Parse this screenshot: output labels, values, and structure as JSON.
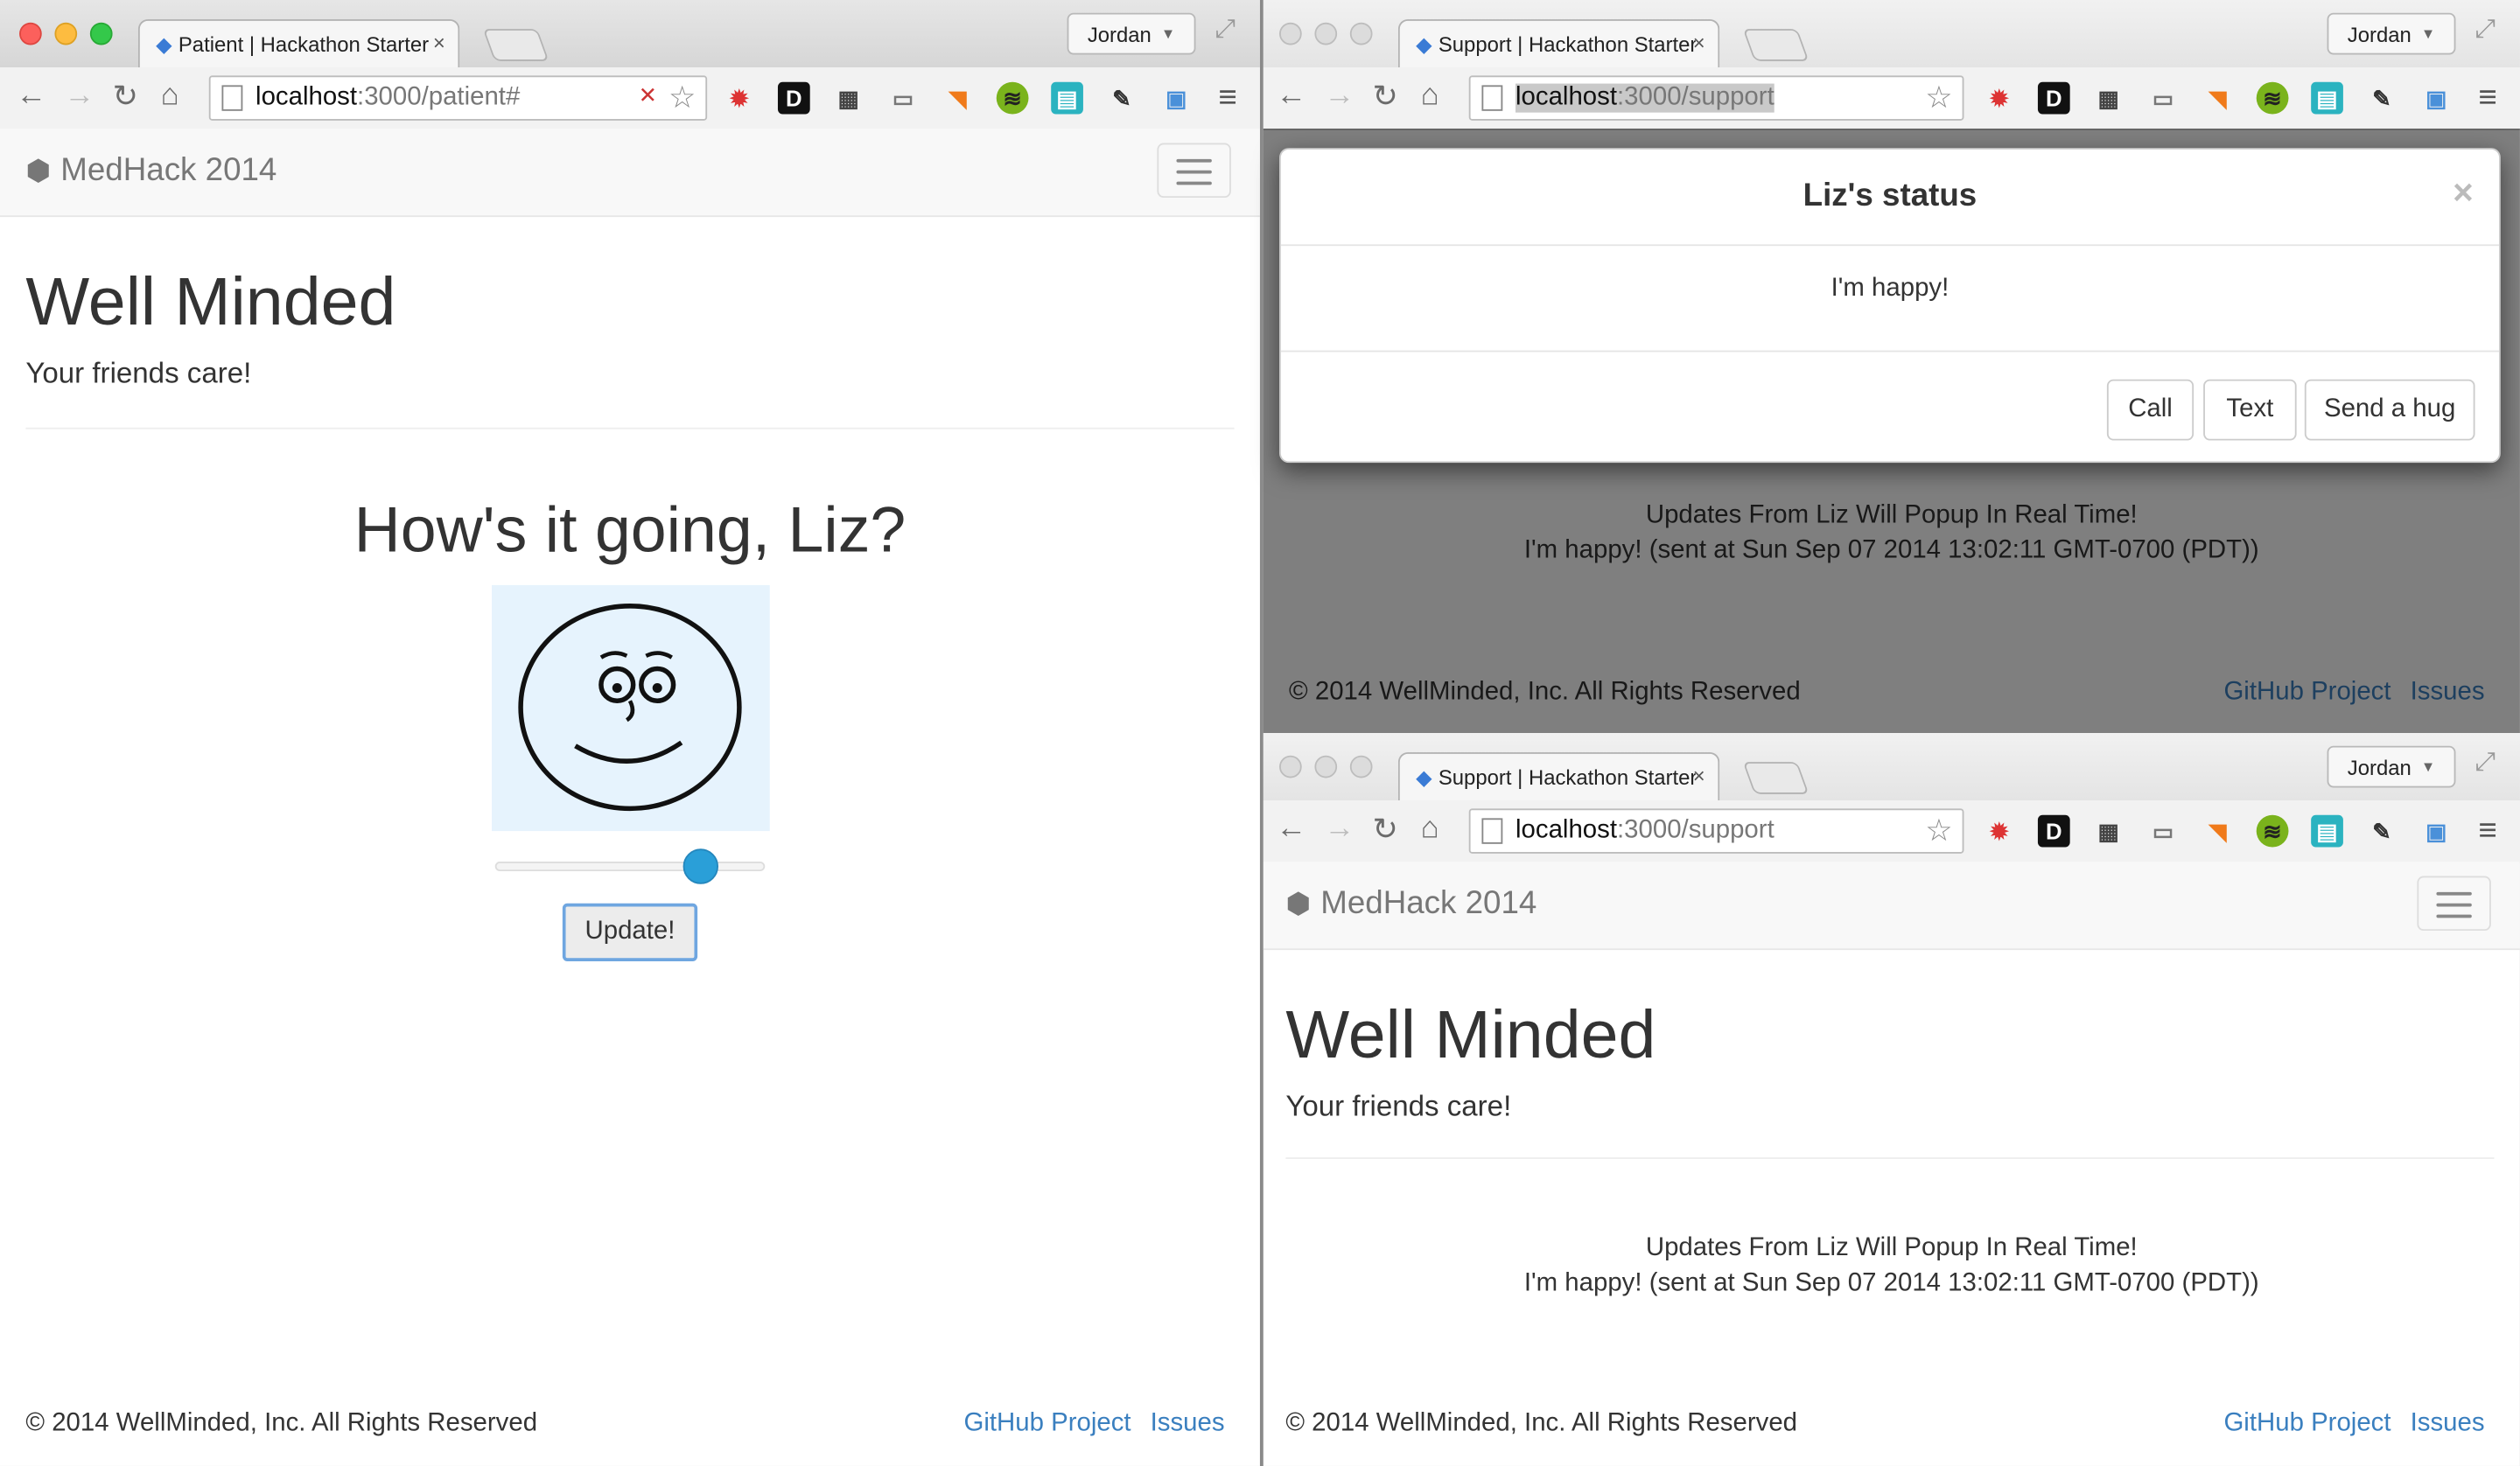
{
  "left_window": {
    "tab_title": "Patient | Hackathon Starter",
    "profile": "Jordan",
    "url_host": "localhost",
    "url_path": ":3000/patient#",
    "brand": "MedHack 2014",
    "heading": "Well Minded",
    "subheading": "Your friends care!",
    "greeting": "How's it going, Liz?",
    "mood_slider_fraction": 0.8,
    "update_button": "Update!",
    "footer_copyright": "© 2014 WellMinded, Inc. All Rights Reserved",
    "footer_link_github": "GitHub Project",
    "footer_link_issues": "Issues"
  },
  "right_top_window": {
    "tab_title": "Support | Hackathon Starter",
    "profile": "Jordan",
    "url_host": "localhost",
    "url_path": ":3000/support",
    "modal": {
      "title": "Liz's status",
      "close": "×",
      "body": "I'm happy!",
      "buttons": [
        "Call",
        "Text",
        "Send a hug"
      ]
    },
    "updates_line": "Updates From Liz Will Popup In Real Time!",
    "status_line": "I'm happy! (sent at Sun Sep 07 2014 13:02:11 GMT-0700 (PDT))",
    "footer_copyright": "© 2014 WellMinded, Inc. All Rights Reserved",
    "footer_link_github": "GitHub Project",
    "footer_link_issues": "Issues"
  },
  "right_bottom_window": {
    "tab_title": "Support | Hackathon Starter",
    "profile": "Jordan",
    "url_host": "localhost",
    "url_path": ":3000/support",
    "brand": "MedHack 2014",
    "heading": "Well Minded",
    "subheading": "Your friends care!",
    "updates_line": "Updates From Liz Will Popup In Real Time!",
    "status_line": "I'm happy! (sent at Sun Sep 07 2014 13:02:11 GMT-0700 (PDT))",
    "footer_copyright": "© 2014 WellMinded, Inc. All Rights Reserved",
    "footer_link_github": "GitHub Project",
    "footer_link_issues": "Issues"
  },
  "icons": {
    "back": "←",
    "forward": "→",
    "reload": "↻",
    "home": "⌂",
    "star": "☆",
    "menu": "≡",
    "tab_close": "×",
    "fullscreen": "⤢"
  }
}
